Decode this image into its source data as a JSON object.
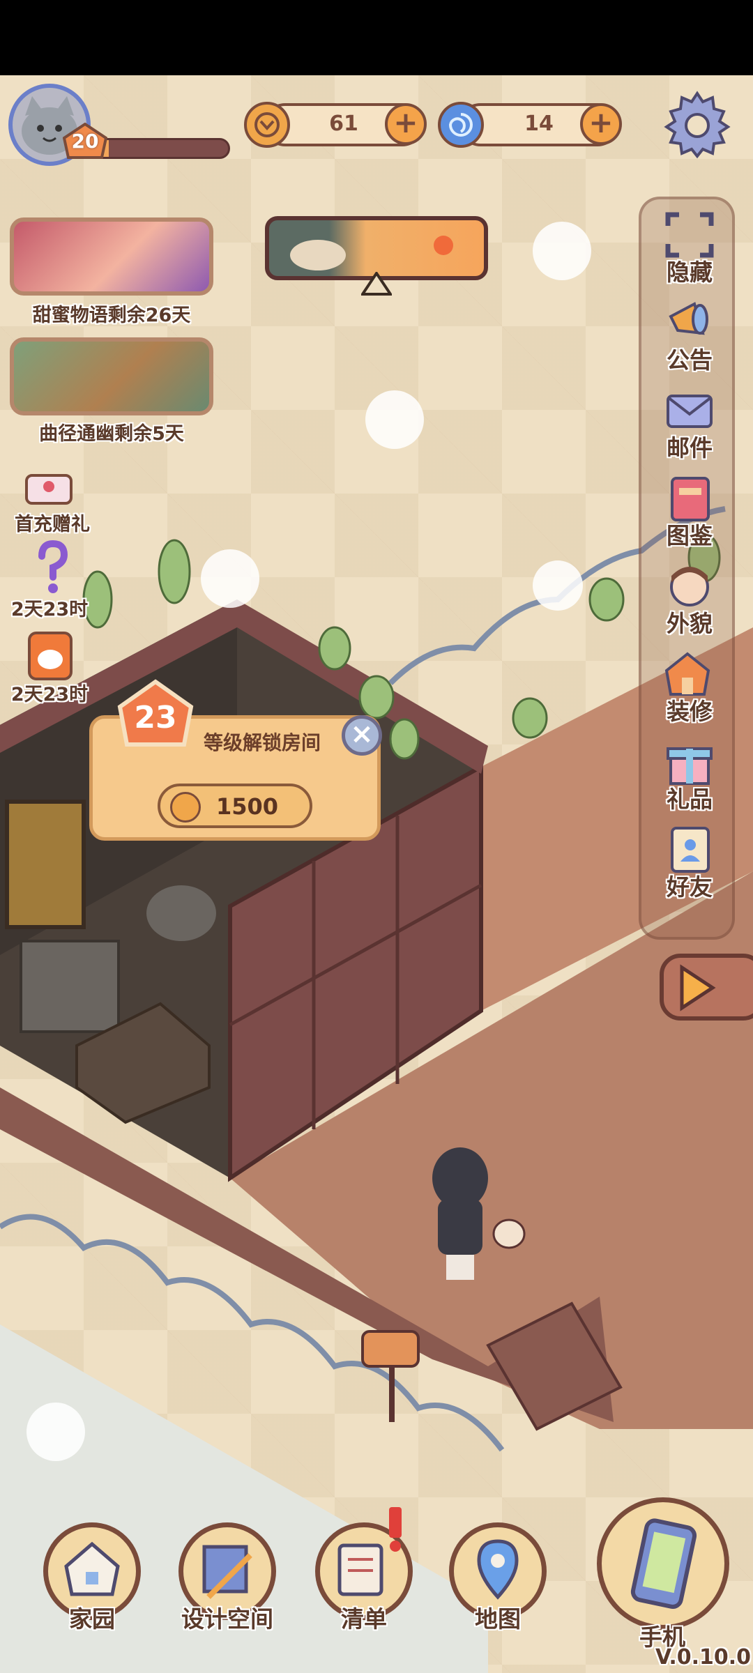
{
  "player": {
    "level": "20",
    "xp_fraction": 0.12
  },
  "currencies": [
    {
      "name": "coin",
      "icon": "coin-icon",
      "value": "61"
    },
    {
      "name": "gem",
      "icon": "swirl-gem-icon",
      "value": "14"
    }
  ],
  "events": [
    {
      "label": "甜蜜物语剩余26天"
    },
    {
      "label": "曲径通幽剩余5天"
    }
  ],
  "promos": [
    {
      "icon": "gift-box-icon",
      "label": "首充赠礼"
    },
    {
      "icon": "question-mark-icon",
      "label": "2天23时"
    },
    {
      "icon": "cat-package-icon",
      "label": "2天23时"
    }
  ],
  "side_menu": [
    {
      "icon": "hide-frame-icon",
      "label": "隐藏"
    },
    {
      "icon": "megaphone-icon",
      "label": "公告"
    },
    {
      "icon": "mail-icon",
      "label": "邮件"
    },
    {
      "icon": "book-icon",
      "label": "图鉴"
    },
    {
      "icon": "character-face-icon",
      "label": "外貌"
    },
    {
      "icon": "house-wrench-icon",
      "label": "装修"
    },
    {
      "icon": "gift-icon",
      "label": "礼品"
    },
    {
      "icon": "contact-book-icon",
      "label": "好友"
    }
  ],
  "unlock_popup": {
    "level": "23",
    "title": "等级解锁房间",
    "cost": "1500"
  },
  "bottom_nav": [
    {
      "icon": "home-icon",
      "label": "家园"
    },
    {
      "icon": "blueprint-icon",
      "label": "设计空间"
    },
    {
      "icon": "checklist-icon",
      "label": "清单"
    },
    {
      "icon": "map-pin-icon",
      "label": "地图"
    },
    {
      "icon": "phone-icon",
      "label": "手机"
    }
  ],
  "version": "V.0.10.0",
  "colors": {
    "brown_outline": "#7a4b3a",
    "accent_orange": "#f4a34a",
    "floor": "#b7826a",
    "wall": "#7d4c4a"
  }
}
